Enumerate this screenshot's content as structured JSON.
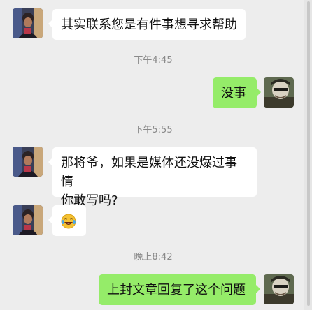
{
  "messages": {
    "m1": "其实联系您是有件事想寻求帮助",
    "t1": "下午4:45",
    "m2": "没事",
    "t2": "下午5:55",
    "m3_line1": "那将爷，如果是媒体还没爆过事情",
    "m3_line2": "你敢写吗?",
    "m4_emoji": "laughing-with-tears-emoji",
    "t3": "晚上8:42",
    "m5": "上封文章回复了这个问题"
  },
  "colors": {
    "background": "#ededed",
    "incoming_bubble": "#ffffff",
    "outgoing_bubble": "#95ec69",
    "time_text": "#8a8a8a"
  }
}
